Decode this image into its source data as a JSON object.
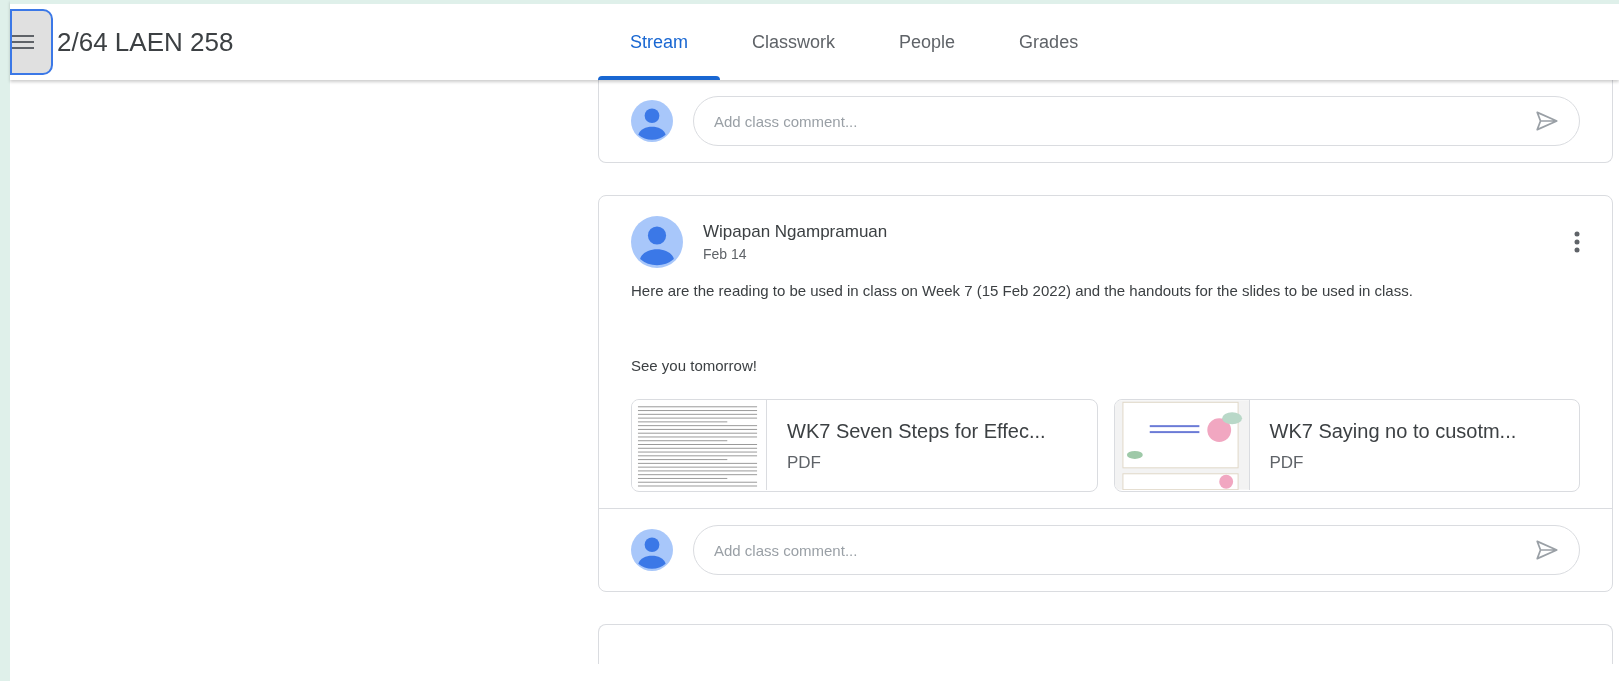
{
  "header": {
    "title": "2/64 LAEN 258"
  },
  "tabs": [
    {
      "label": "Stream",
      "selected": true
    },
    {
      "label": "Classwork",
      "selected": false
    },
    {
      "label": "People",
      "selected": false
    },
    {
      "label": "Grades",
      "selected": false
    }
  ],
  "top_comment": {
    "placeholder": "Add class comment..."
  },
  "post": {
    "author": "Wipapan Ngampramuan",
    "date": "Feb 14",
    "paragraphs": [
      "Here are the reading to be used in class on Week 7 (15 Feb 2022) and the handouts for the slides to be used in class.",
      "See you tomorrow!"
    ],
    "attachments": [
      {
        "kind": "document",
        "title": "WK7 Seven Steps for Effec...",
        "type": "PDF"
      },
      {
        "kind": "slides",
        "title": "WK7 Saying no to cusotm...",
        "type": "PDF"
      }
    ],
    "comment": {
      "placeholder": "Add class comment..."
    }
  }
}
